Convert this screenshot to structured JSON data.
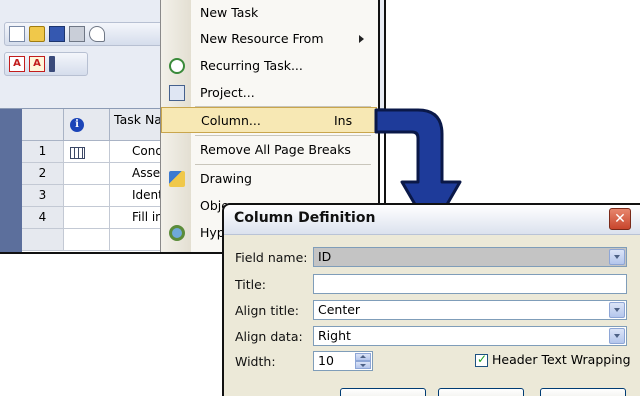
{
  "menu": {
    "items": [
      {
        "label": "New Task",
        "shortcut": "",
        "submenu": false,
        "icon": ""
      },
      {
        "label": "New Resource From",
        "shortcut": "",
        "submenu": true,
        "icon": ""
      },
      {
        "label": "Recurring Task...",
        "shortcut": "",
        "submenu": false,
        "icon": "recurring-task-icon"
      },
      {
        "label": "Project...",
        "shortcut": "",
        "submenu": false,
        "icon": "project-icon"
      },
      {
        "label": "Column...",
        "shortcut": "Ins",
        "submenu": false,
        "icon": "",
        "highlighted": true
      },
      {
        "label": "Remove All Page Breaks",
        "shortcut": "",
        "submenu": false,
        "icon": ""
      },
      {
        "label": "Drawing",
        "shortcut": "",
        "submenu": false,
        "icon": "drawing-icon"
      },
      {
        "label": "Obje",
        "shortcut": "",
        "submenu": false,
        "icon": ""
      },
      {
        "label": "Hyp",
        "shortcut": "",
        "submenu": false,
        "icon": "hyperlink-icon"
      }
    ]
  },
  "grid": {
    "header_task_name": "Task Na",
    "rows": [
      {
        "num": "1",
        "name": "Cond"
      },
      {
        "num": "2",
        "name": "Asse"
      },
      {
        "num": "3",
        "name": "Ident"
      },
      {
        "num": "4",
        "name": "Fill in"
      }
    ]
  },
  "dialog": {
    "title": "Column Definition",
    "close_glyph": "✕",
    "fields": {
      "field_name_label": "Field name:",
      "field_name_value": "ID",
      "title_label": "Title:",
      "title_value": "",
      "align_title_label": "Align title:",
      "align_title_value": "Center",
      "align_data_label": "Align data:",
      "align_data_value": "Right",
      "width_label": "Width:",
      "width_value": "10",
      "header_wrap_label": "Header Text Wrapping",
      "header_wrap_checked": true
    }
  },
  "colors": {
    "arrow_fill": "#1e3b9a",
    "menu_highlight": "#f7e8b4",
    "close_button": "#c8452c"
  }
}
